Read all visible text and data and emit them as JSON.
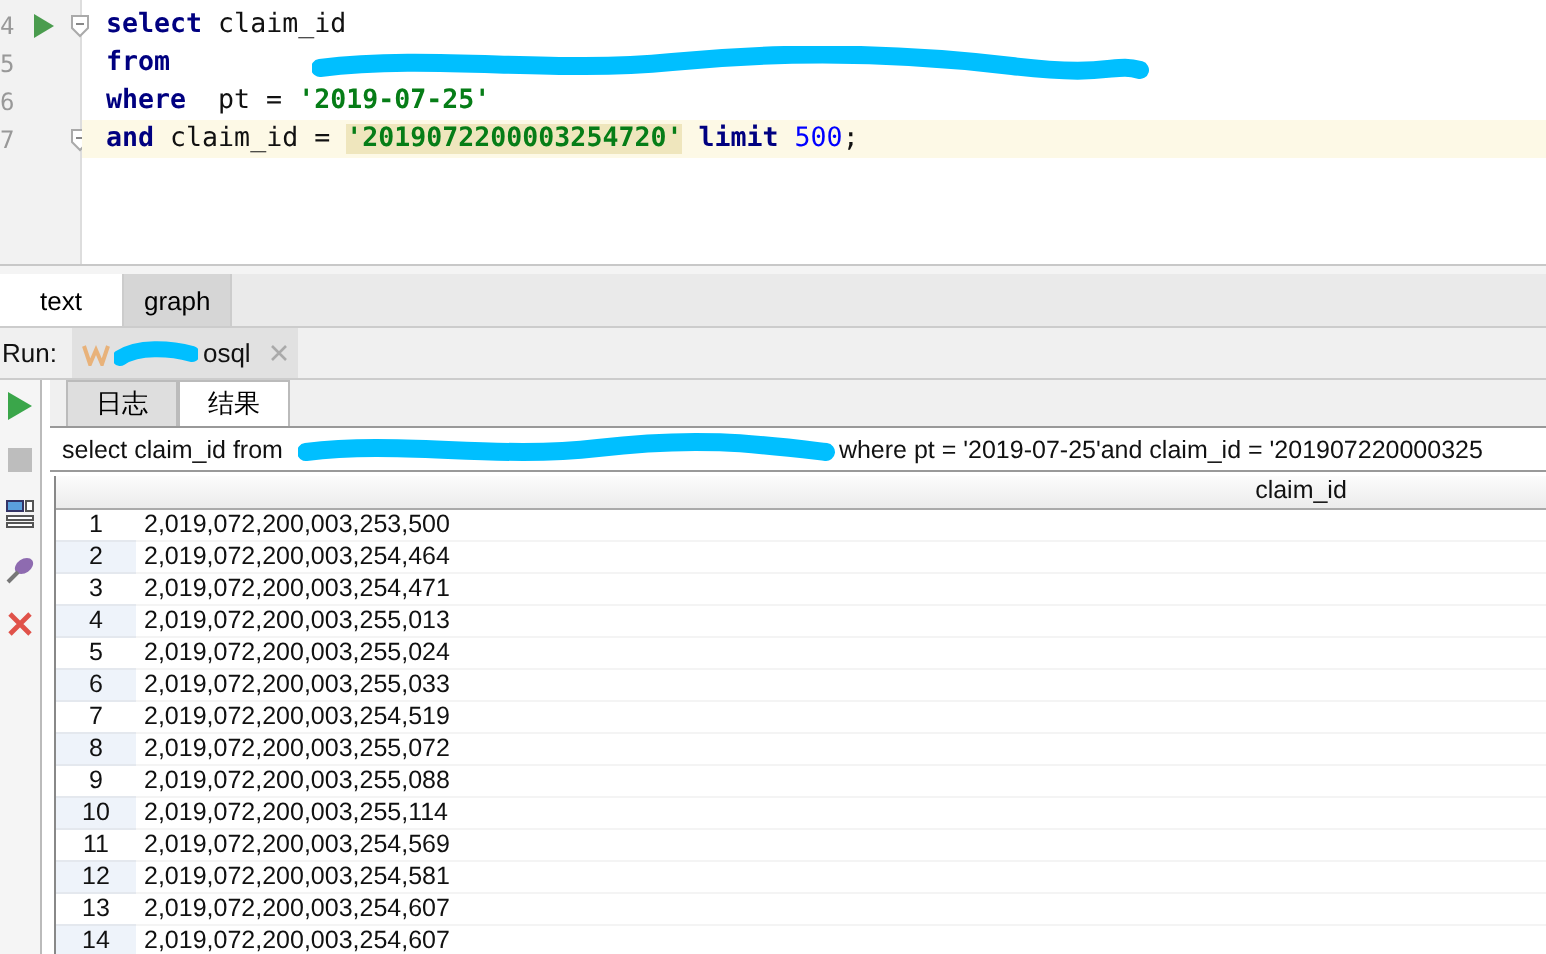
{
  "editor": {
    "lines": [
      {
        "number": "4",
        "current": false,
        "run_marker": true,
        "fold": true,
        "redacted": false,
        "tokens": [
          {
            "kind": "keyword",
            "text": "select"
          },
          {
            "kind": "plain",
            "text": " claim_id"
          }
        ]
      },
      {
        "number": "5",
        "current": false,
        "run_marker": false,
        "fold": false,
        "redacted": true,
        "tokens": [
          {
            "kind": "keyword",
            "text": "from"
          }
        ]
      },
      {
        "number": "6",
        "current": false,
        "run_marker": false,
        "fold": false,
        "redacted": false,
        "tokens": [
          {
            "kind": "keyword",
            "text": "where"
          },
          {
            "kind": "plain",
            "text": "  pt = "
          },
          {
            "kind": "string",
            "text": "'2019-07-25'"
          }
        ]
      },
      {
        "number": "7",
        "current": true,
        "run_marker": false,
        "fold": true,
        "redacted": false,
        "tokens": [
          {
            "kind": "keyword",
            "text": "and"
          },
          {
            "kind": "plain",
            "text": " claim_id = "
          },
          {
            "kind": "string-match",
            "text": "'2019072200003254720'"
          },
          {
            "kind": "keyword",
            "text": " limit"
          },
          {
            "kind": "number",
            "text": " 500"
          },
          {
            "kind": "plain",
            "text": ";"
          }
        ]
      }
    ]
  },
  "view_tabs": [
    {
      "label": "text",
      "selected": true
    },
    {
      "label": "graph",
      "selected": false
    }
  ],
  "run_bar": {
    "label": "Run:",
    "tab": {
      "label": "osql",
      "redacted": true
    }
  },
  "result_tabs": [
    {
      "label": "日志",
      "selected": false
    },
    {
      "label": "结果",
      "selected": true
    }
  ],
  "query": {
    "before": "select claim_id from",
    "after": "where  pt = '2019-07-25'and claim_id = '201907220000325",
    "redacted": true
  },
  "table": {
    "columns": [
      "claim_id"
    ],
    "rows": [
      {
        "index": "1",
        "claim_id": "2,019,072,200,003,253,500"
      },
      {
        "index": "2",
        "claim_id": "2,019,072,200,003,254,464"
      },
      {
        "index": "3",
        "claim_id": "2,019,072,200,003,254,471"
      },
      {
        "index": "4",
        "claim_id": "2,019,072,200,003,255,013"
      },
      {
        "index": "5",
        "claim_id": "2,019,072,200,003,255,024"
      },
      {
        "index": "6",
        "claim_id": "2,019,072,200,003,255,033"
      },
      {
        "index": "7",
        "claim_id": "2,019,072,200,003,254,519"
      },
      {
        "index": "8",
        "claim_id": "2,019,072,200,003,255,072"
      },
      {
        "index": "9",
        "claim_id": "2,019,072,200,003,255,088"
      },
      {
        "index": "10",
        "claim_id": "2,019,072,200,003,255,114"
      },
      {
        "index": "11",
        "claim_id": "2,019,072,200,003,254,569"
      },
      {
        "index": "12",
        "claim_id": "2,019,072,200,003,254,581"
      },
      {
        "index": "13",
        "claim_id": "2,019,072,200,003,254,607"
      },
      {
        "index": "14",
        "claim_id": "2,019,072,200,003,254,607"
      }
    ]
  }
}
